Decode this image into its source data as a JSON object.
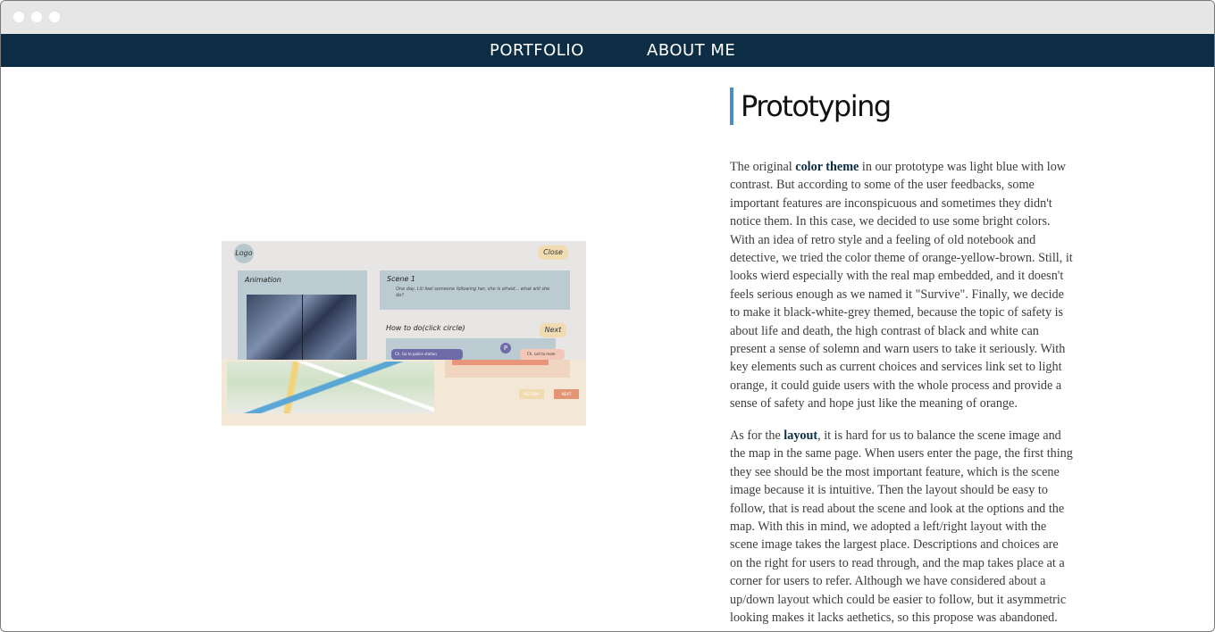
{
  "nav": {
    "portfolio_label": "PORTFOLIO",
    "about_label": "ABOUT ME"
  },
  "colors": {
    "nav_bg": "#0c2d44",
    "accent": "#4a8cc4",
    "titlebar": "#e6e6e6"
  },
  "prototype_image": {
    "logo": "Logo",
    "close": "Close",
    "animation": "Animation",
    "scene_title": "Scene 1",
    "scene_text": "One day, Lili feel someone following her, she is afraid... what will she do?",
    "howto": "How to do(click circle)",
    "next": "Next",
    "choice_a": "Ch. Go to police station",
    "choice_b": "Ch. call to mom",
    "pin": "P",
    "return": "RETURN",
    "next_small": "NEXT"
  },
  "article": {
    "heading": "Prototyping",
    "p1_a": "The original ",
    "p1_kw": "color theme",
    "p1_b": " in our prototype was light blue with low contrast. But according to some of the user feedbacks, some important features are inconspicuous and sometimes they didn't notice them. In this case, we decided to use some bright colors. With an idea of retro style and a feeling of old notebook and detective, we tried the color theme of orange-yellow-brown. Still, it looks wierd especially with the real map embedded, and it doesn't feels serious enough as we named it \"Survive\". Finally, we decide to make it black-white-grey themed, because the topic of safety is about life and death, the high contrast of black and white can present a sense of solemn and warn users to take it seriously. With key elements such as current choices and services link set to light orange, it could guide users with the whole process and provide a sense of safety and hope just like the meaning of orange.",
    "p2_a": "As for the ",
    "p2_kw": "layout",
    "p2_b": ", it is hard for us to balance the scene image and the map in the same page. When users enter the page, the first thing they see should be the most important feature, which is the scene image because it is intuitive. Then the layout should be easy to follow, that is read about the scene and look at the options and the map. With this in mind, we adopted a left/right layout with the scene image takes the largest place. Descriptions and choices are on the right for users to read through, and the map takes place at a corner for users to refer. Although we have considered about a up/down layout which could be easier to follow, but it asymmetric looking makes it lacks aethetics, so this propose was abandoned."
  }
}
